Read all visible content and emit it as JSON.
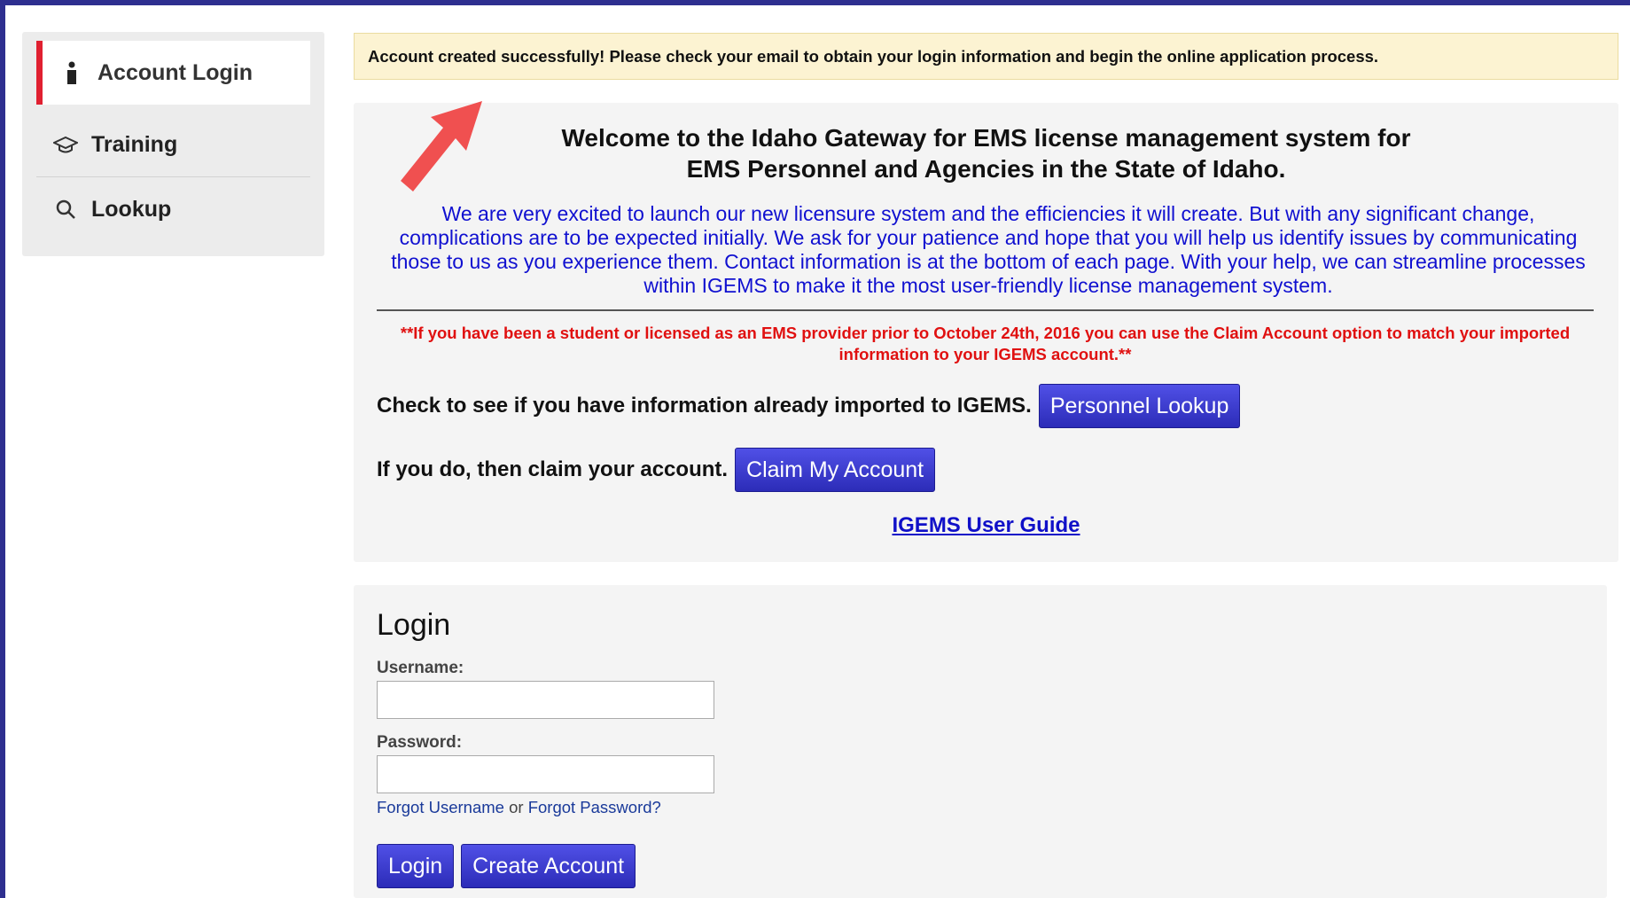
{
  "sidebar": {
    "items": [
      {
        "label": "Account Login",
        "icon": "person-icon"
      },
      {
        "label": "Training",
        "icon": "graduation-cap-icon"
      },
      {
        "label": "Lookup",
        "icon": "search-icon"
      }
    ]
  },
  "alert": {
    "message": "Account created successfully! Please check your email to obtain your login information and begin the online application process."
  },
  "welcome": {
    "title_line1": "Welcome to the Idaho Gateway for EMS license management system for",
    "title_line2": "EMS Personnel and Agencies in the State of Idaho.",
    "intro": "We are very excited to launch our new licensure system and the efficiencies it will create. But with any significant change, complications are to be expected initially. We ask for your patience and hope that you will help us identify issues by communicating those to us as you experience them. Contact information is at the bottom of each page. With your help, we can streamline processes within IGEMS to make it the most user-friendly license management system.",
    "warning": "**If you have been a student or licensed as an EMS provider prior to October 24th, 2016 you can use the Claim Account option to match your imported information to your IGEMS account.**",
    "check_text": "Check to see if you have information already imported to IGEMS.",
    "personnel_lookup_label": "Personnel Lookup",
    "claim_text": "If you do, then claim your account.",
    "claim_button_label": "Claim My Account",
    "user_guide_link": "IGEMS User Guide"
  },
  "login": {
    "heading": "Login",
    "username_label": "Username:",
    "username_value": "",
    "password_label": "Password:",
    "password_value": "",
    "forgot_username": "Forgot Username",
    "or_text": "or",
    "forgot_password": "Forgot Password?",
    "login_button": "Login",
    "create_account_button": "Create Account"
  },
  "colors": {
    "accent": "#2e2f8f",
    "button": "#3a3ad0",
    "active_marker": "#e02030",
    "warning": "#e01010",
    "intro_text": "#1010d0",
    "alert_bg": "#fcf3d2",
    "annotation_arrow": "#f05050"
  }
}
